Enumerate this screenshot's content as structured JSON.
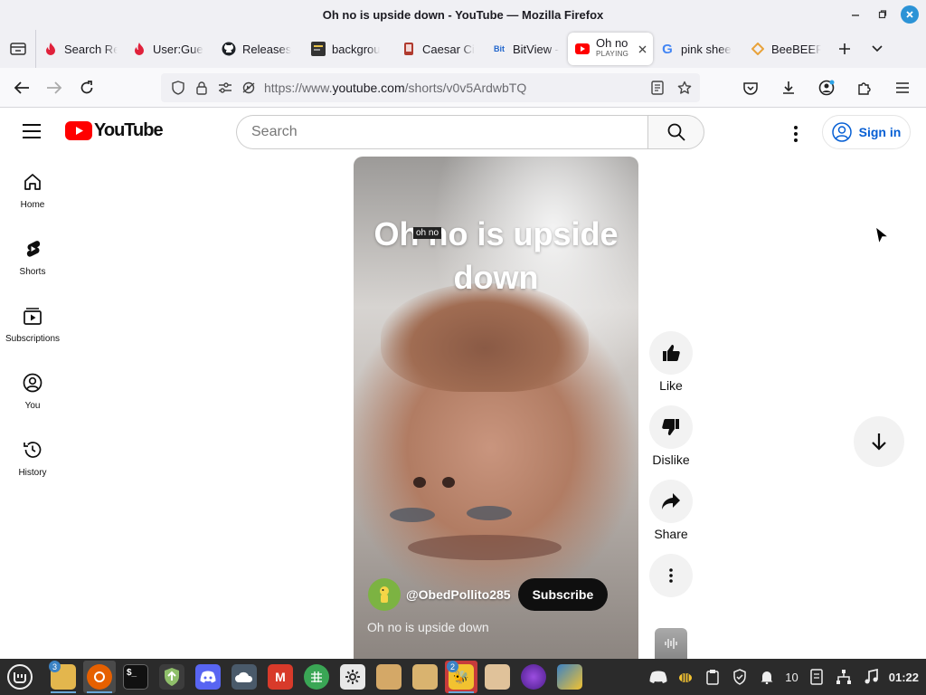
{
  "window": {
    "title": "Oh no is upside down - YouTube — Mozilla Firefox"
  },
  "tabs": [
    {
      "title": "Search Re",
      "favicon": "flame-icon",
      "color": "#e0213b"
    },
    {
      "title": "User:Gue",
      "favicon": "flame-icon",
      "color": "#e0213b"
    },
    {
      "title": "Releases",
      "favicon": "github-icon",
      "color": "#1f2328"
    },
    {
      "title": "backgrou",
      "favicon": "code-icon",
      "color": "#333333"
    },
    {
      "title": "Caesar Ci",
      "favicon": "tablet-icon",
      "color": "#b03a2e"
    },
    {
      "title": "BitView -",
      "favicon": "bitview-icon",
      "color": "#2266cc"
    },
    {
      "title": "Oh no",
      "subtitle": "PLAYING",
      "favicon": "youtube-icon",
      "color": "#ff0000",
      "active": true
    },
    {
      "title": "pink shee",
      "favicon": "google-icon",
      "color": "#4285f4"
    },
    {
      "title": "BeeBEEP",
      "favicon": "diamond-icon",
      "color": "#e8a23a"
    }
  ],
  "nav": {
    "url_prefix": "https://www.",
    "url_domain": "youtube.com",
    "url_path": "/shorts/v0v5ArdwbTQ"
  },
  "youtube": {
    "brand": "YouTube",
    "search_placeholder": "Search",
    "sign_in": "Sign in",
    "guide": [
      {
        "label": "Home",
        "icon": "home-icon"
      },
      {
        "label": "Shorts",
        "icon": "shorts-icon"
      },
      {
        "label": "Subscriptions",
        "icon": "subscriptions-icon"
      },
      {
        "label": "You",
        "icon": "you-icon"
      },
      {
        "label": "History",
        "icon": "history-icon"
      }
    ],
    "short": {
      "overlay_title": "Oh no is upside down",
      "tooltip": "oh no",
      "channel": "@ObedPollito285",
      "subscribe": "Subscribe",
      "caption": "Oh no is upside down"
    },
    "actions": {
      "like": "Like",
      "dislike": "Dislike",
      "share": "Share"
    }
  },
  "taskbar": {
    "files_badge": "3",
    "beebeep_badge": "2",
    "tray_number": "10",
    "clock": "01:22"
  },
  "colors": {
    "youtube_red": "#ff0000",
    "link_blue": "#065fd4",
    "taskbar_bg": "#2b2b2b"
  }
}
